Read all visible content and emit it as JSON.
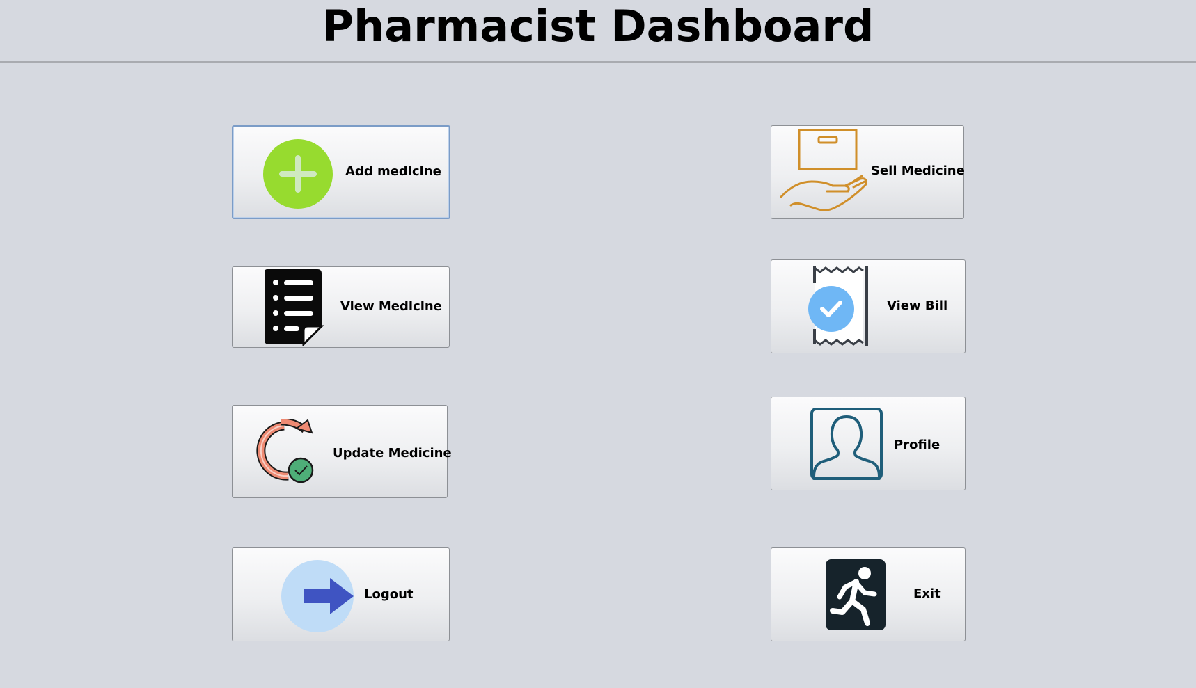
{
  "window": {
    "title": "Pharmacist Dashboard"
  },
  "buttons": {
    "add_medicine": {
      "label": "Add medicine",
      "icon": "plus-circle-icon"
    },
    "view_medicine": {
      "label": "View Medicine",
      "icon": "list-document-icon"
    },
    "update_medicine": {
      "label": "Update Medicine",
      "icon": "refresh-check-icon"
    },
    "logout": {
      "label": "Logout",
      "icon": "arrow-right-icon"
    },
    "sell_medicine": {
      "label": "Sell Medicine",
      "icon": "hand-box-icon"
    },
    "view_bill": {
      "label": "View Bill",
      "icon": "receipt-check-icon"
    },
    "profile": {
      "label": "Profile",
      "icon": "user-portrait-icon"
    },
    "exit": {
      "label": "Exit",
      "icon": "running-man-icon"
    }
  },
  "colors": {
    "background": "#d6d9e0",
    "add_icon": "#97db2f",
    "sell_icon": "#d08f2a",
    "bill_check": "#6fb7f5",
    "profile_icon": "#1f5e7a",
    "exit_icon": "#16232b",
    "logout_circle": "#bfdcf7",
    "logout_arrow": "#3f54c2",
    "update_arrow": "#ee8a73",
    "update_check": "#4eae78"
  }
}
